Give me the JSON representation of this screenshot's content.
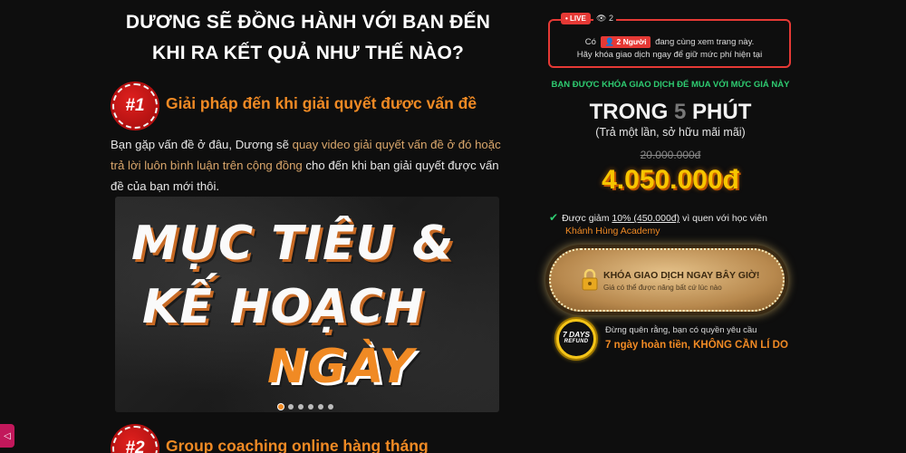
{
  "heading": {
    "line1": "DƯƠNG SẼ ĐỒNG HÀNH VỚI BẠN ĐẾN",
    "line2": "KHI RA KẾT QUẢ NHƯ THẾ NÀO?"
  },
  "steps": [
    {
      "badge": "#1",
      "title": "Giải pháp đến khi giải quyết được vấn đề"
    },
    {
      "badge": "#2",
      "title": "Group coaching online hàng tháng"
    }
  ],
  "paragraph": {
    "part1": "Bạn gặp vấn đề ở đâu, Dương sẽ ",
    "highlight": "quay video giải quyết vấn đề ở đó hoặc trả lời luôn bình luận trên cộng đồng",
    "part2": " cho đến khi bạn giải quyết được vấn đề của bạn mới thôi."
  },
  "video": {
    "line1": "MỤC TIÊU &",
    "line2": "KẾ HOẠCH",
    "line3": "NGÀY",
    "slide_count": 6,
    "active_slide": 0
  },
  "live": {
    "badge": "• LIVE",
    "viewer_count": "2",
    "line1_prefix": "Có",
    "people": "2 Người",
    "line1_suffix": "đang cùng xem trang này.",
    "line2": "Hãy khóa giao dịch ngay để giữ mức phí hiện tại"
  },
  "offer": {
    "headline": "BẠN ĐƯỢC KHÓA GIAO DỊCH ĐỂ MUA VỚI MỨC GIÁ NÀY",
    "timer_prefix": "TRONG",
    "timer_value": "5",
    "timer_suffix": "PHÚT",
    "note": "(Trả một lần, sở hữu mãi mãi)",
    "old_price": "20.000.000đ",
    "price": "4.050.000đ",
    "discount_text": "Được giảm",
    "discount_value": "10% (450.000đ)",
    "discount_reason": "vì quen với học viên",
    "academy": "Khánh Hùng Academy"
  },
  "cta": {
    "label": "KHÓA GIAO DỊCH NGAY BÂY GIỜ!",
    "sub": "Giá có thể được nâng bất cứ lúc nào"
  },
  "refund": {
    "badge_days": "7 DAYS",
    "badge_word": "REFUND",
    "line1": "Đừng quên rằng, bạn có quyền yêu cầu",
    "line2": "7 ngày hoàn tiền, KHÔNG CẦN LÍ DO"
  },
  "colors": {
    "accent_orange": "#f08a24",
    "live_red": "#e53935",
    "green": "#2ecc71",
    "price_yellow": "#f7c600"
  }
}
